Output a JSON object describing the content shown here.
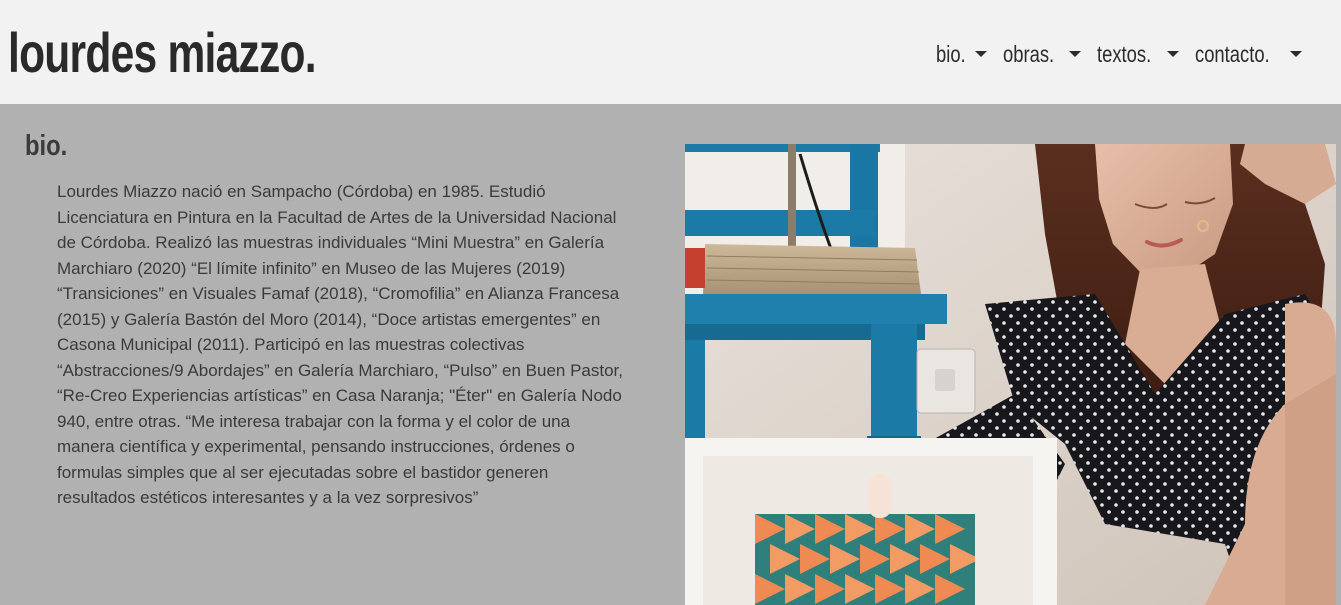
{
  "header": {
    "site_title": "lourdes miazzo.",
    "nav": [
      {
        "label": "bio."
      },
      {
        "label": "obras."
      },
      {
        "label": "textos."
      },
      {
        "label": "contacto."
      }
    ]
  },
  "main": {
    "section_title": "bio.",
    "bio_text": "Lourdes Miazzo nació en Sampacho (Córdoba) en 1985. Estudió Licenciatura en Pintura en la Facultad de Artes de la Universidad Nacional de Córdoba. Realizó las muestras individuales “Mini Muestra” en Galería Marchiaro (2020) “El límite infinito” en Museo de las Mujeres (2019) “Transiciones” en Visuales Famaf (2018), “Cromofilia” en Alianza Francesa (2015) y Galería Bastón del Moro (2014), “Doce artistas emergentes” en Casona Municipal (2011). Participó en las muestras colectivas “Abstracciones/9 Abordajes” en Galería Marchiaro, “Pulso” en Buen Pastor, “Re-Creo Experiencias artísticas” en Casa Naranja; \"Éter\" en Galería Nodo 940, entre otras. “Me interesa trabajar con la forma y el color de una manera científica y experimental, pensando instrucciones, órdenes o formulas simples que al ser ejecutadas sobre el bastidor generen resultados estéticos interesantes y a la vez sorpresivos”"
  },
  "colors": {
    "header_bg": "#f2f2f2",
    "page_bg": "#b1b1b1",
    "text": "#3a3a3a",
    "chair_blue": "#1c7aa6",
    "artwork_orange": "#ef8a52",
    "artwork_teal": "#2f7f7c"
  }
}
